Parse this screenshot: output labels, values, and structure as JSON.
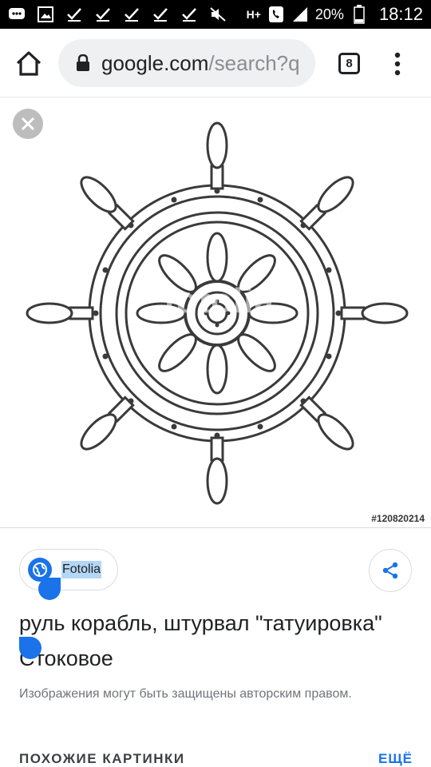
{
  "status_bar": {
    "battery": "20%",
    "time": "18:12",
    "network": "H+",
    "left_icons": [
      "chat-icon",
      "image-icon",
      "check-icon",
      "check-icon",
      "check-icon",
      "check-icon",
      "check-icon",
      "mute-icon"
    ]
  },
  "browser": {
    "url_domain": "google.com",
    "url_path": "/search?q",
    "tab_count": "8"
  },
  "image": {
    "watermark": "fotolia",
    "stock_id": "#120820214"
  },
  "result": {
    "source": "Fotolia",
    "title": "руль корабль, штурвал \"татуировка\" Стоковое",
    "copyright_note": "Изображения могут быть защищены авторским правом.",
    "similar_label": "ПОХОЖИЕ КАРТИНКИ",
    "more_label": "ЕЩЁ"
  },
  "colors": {
    "accent": "#1a73e8",
    "selection": "#b3d7f5"
  }
}
